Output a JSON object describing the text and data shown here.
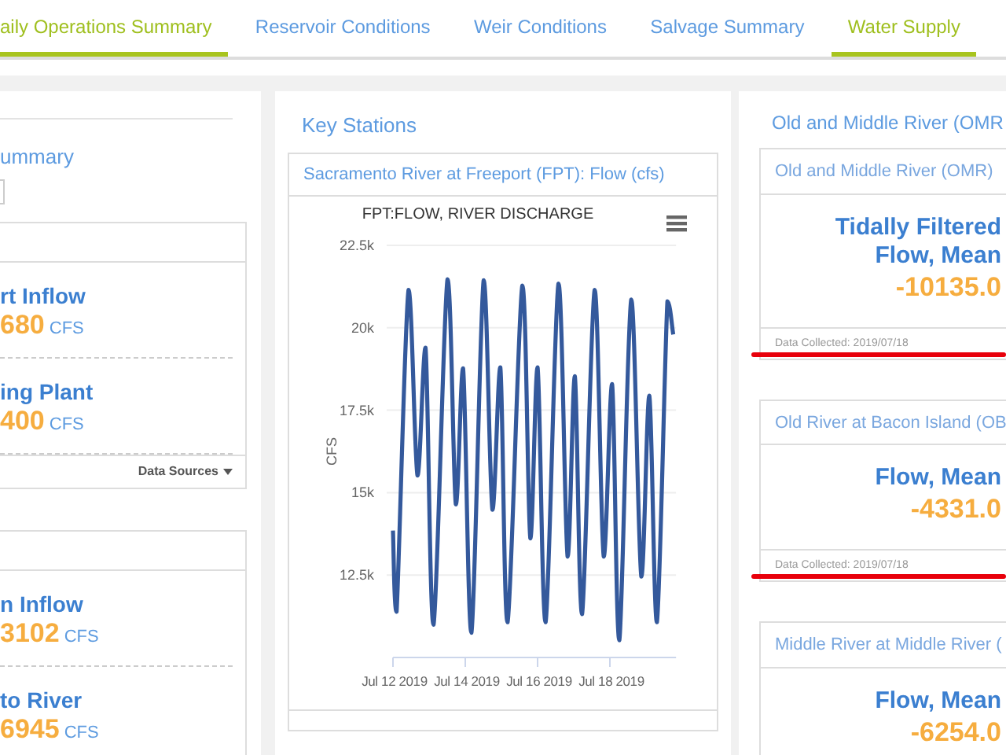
{
  "tabs": [
    {
      "label": "aily Operations Summary",
      "selected": true
    },
    {
      "label": "Reservoir Conditions",
      "selected": false
    },
    {
      "label": "Weir Conditions",
      "selected": false
    },
    {
      "label": "Salvage Summary",
      "selected": false
    },
    {
      "label": "Water Supply",
      "selected": true
    }
  ],
  "left_panel": {
    "heading": "ummary",
    "cards": [
      {
        "items": [
          {
            "name": "rt Inflow",
            "value": "680",
            "unit": "CFS"
          },
          {
            "name": "ing Plant",
            "value": "400",
            "unit": "CFS"
          }
        ],
        "footer": "Data Sources"
      },
      {
        "items": [
          {
            "name": "n Inflow",
            "value": "3102",
            "unit": "CFS"
          },
          {
            "name": "to River",
            "value": "6945",
            "unit": "CFS"
          }
        ]
      }
    ]
  },
  "key_stations": {
    "heading": "Key Stations",
    "card_title": "Sacramento River at Freeport (FPT): Flow (cfs)",
    "chart_data": {
      "type": "line",
      "title": "FPT:FLOW, RIVER DISCHARGE",
      "ylabel": "CFS",
      "x": [
        "2019-07-12T00:00",
        "2019-07-12T02:24",
        "2019-07-12T10:19",
        "2019-07-12T16:19",
        "2019-07-12T21:36",
        "2019-07-13T02:53",
        "2019-07-13T12:14",
        "2019-07-13T17:46",
        "2019-07-13T22:34",
        "2019-07-14T04:05",
        "2019-07-14T12:14",
        "2019-07-14T18:00",
        "2019-07-14T23:17",
        "2019-07-15T04:05",
        "2019-07-15T13:55",
        "2019-07-15T19:12",
        "2019-07-16T00:00",
        "2019-07-16T05:17",
        "2019-07-16T13:55",
        "2019-07-16T19:55",
        "2019-07-17T00:43",
        "2019-07-17T05:31",
        "2019-07-17T13:55",
        "2019-07-17T19:55",
        "2019-07-18T01:26",
        "2019-07-18T06:14",
        "2019-07-18T14:10",
        "2019-07-18T20:53",
        "2019-07-19T02:10",
        "2019-07-19T07:12",
        "2019-07-19T14:10",
        "2019-07-19T18:00"
      ],
      "series": [
        {
          "color": "#34599c",
          "values": [
            13850,
            11390,
            21150,
            15520,
            19400,
            10990,
            21470,
            14640,
            18770,
            10750,
            21440,
            14480,
            18800,
            11070,
            21280,
            13610,
            18800,
            11070,
            21340,
            13060,
            18530,
            11310,
            21150,
            13060,
            18290,
            10520,
            20860,
            12450,
            17940,
            11070,
            20800,
            19800
          ]
        }
      ],
      "grid": true,
      "xlim": [
        "2019-07-12T00:00",
        "2019-07-19T19:55"
      ],
      "ylim": [
        10000,
        22500
      ],
      "xticks": [
        {
          "value": "2019-07-12",
          "label": "Jul 12 2019"
        },
        {
          "value": "2019-07-14",
          "label": "Jul 14 2019"
        },
        {
          "value": "2019-07-16",
          "label": "Jul 16 2019"
        },
        {
          "value": "2019-07-18",
          "label": "Jul 18 2019"
        }
      ],
      "yticks": [
        {
          "value": 12500,
          "label": "12.5k"
        },
        {
          "value": 15000,
          "label": "15k"
        },
        {
          "value": 17500,
          "label": "17.5k"
        },
        {
          "value": 20000,
          "label": "20k"
        },
        {
          "value": 22500,
          "label": "22.5k"
        }
      ]
    }
  },
  "omr": {
    "heading": "Old and Middle River (OMR",
    "cards": [
      {
        "title": "Old and Middle River (OMR)",
        "label_lines": [
          "Tidally Filtered",
          "Flow, Mean"
        ],
        "value": "-10135.0",
        "footer": "Data Collected: 2019/07/18",
        "annotated": true
      },
      {
        "title": "Old River at Bacon Island (OB",
        "label_lines": [
          "Flow, Mean"
        ],
        "value": "-4331.0",
        "footer": "Data Collected: 2019/07/18",
        "annotated": true
      },
      {
        "title": "Middle River at Middle River (",
        "label_lines": [
          "Flow, Mean"
        ],
        "value": "-6254.0"
      }
    ]
  }
}
